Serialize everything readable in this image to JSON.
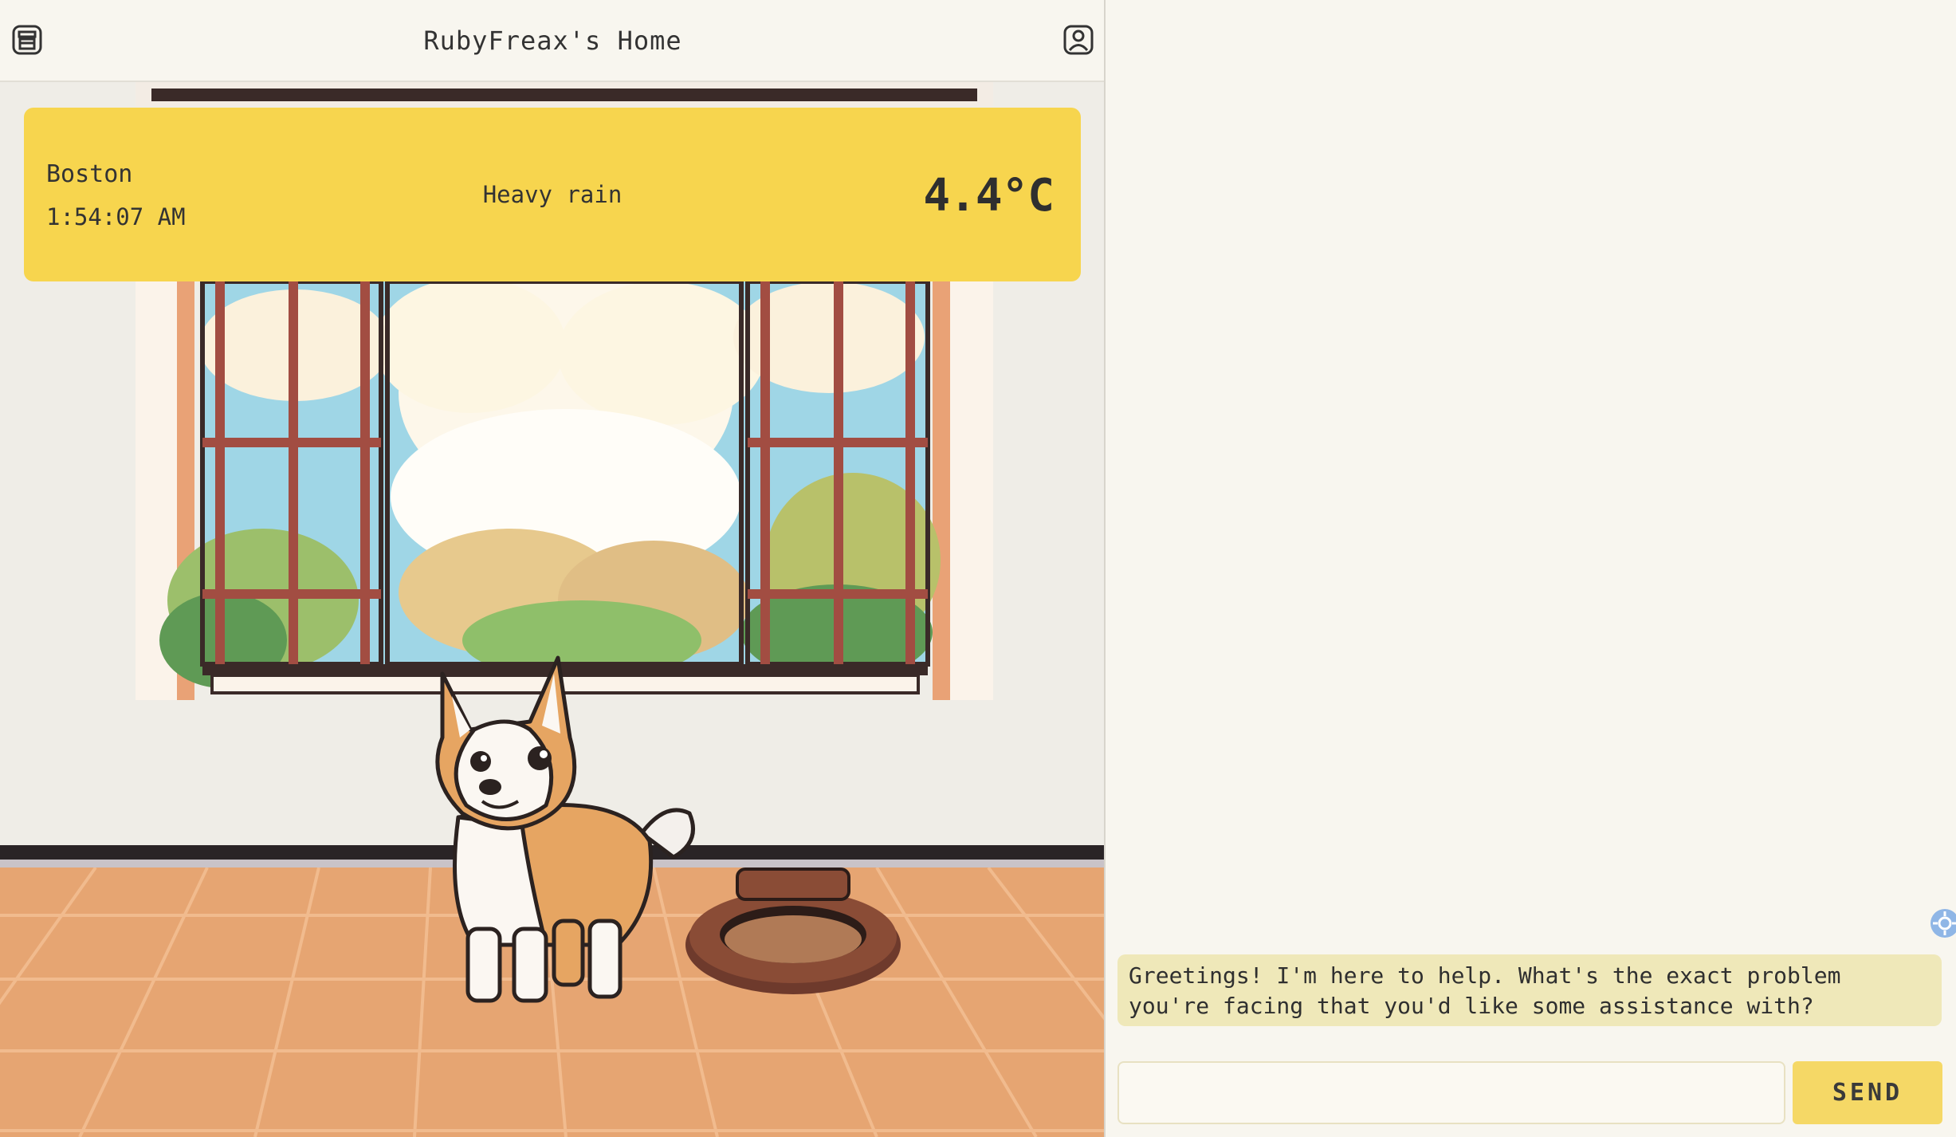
{
  "header": {
    "title": "RubyFreax's Home",
    "left_icon": "shop-icon",
    "right_icon": "user-profile-icon"
  },
  "weather": {
    "city": "Boston",
    "time": "1:54:07 AM",
    "condition": "Heavy rain",
    "temperature": "4.4°C"
  },
  "scene": {
    "pet": "corgi-dog",
    "bed": "pet-bed"
  },
  "chat": {
    "messages": [
      {
        "text": "Greetings! I'm here to help. What's the exact problem you're facing that you'd like some assistance with?"
      }
    ],
    "input_value": "",
    "input_placeholder": "",
    "send_label": "SEND"
  },
  "colors": {
    "weather_card": "#f7d54e",
    "message_bubble": "#efe8b9",
    "send_button": "#f5d866",
    "floor": "#e6a572"
  }
}
